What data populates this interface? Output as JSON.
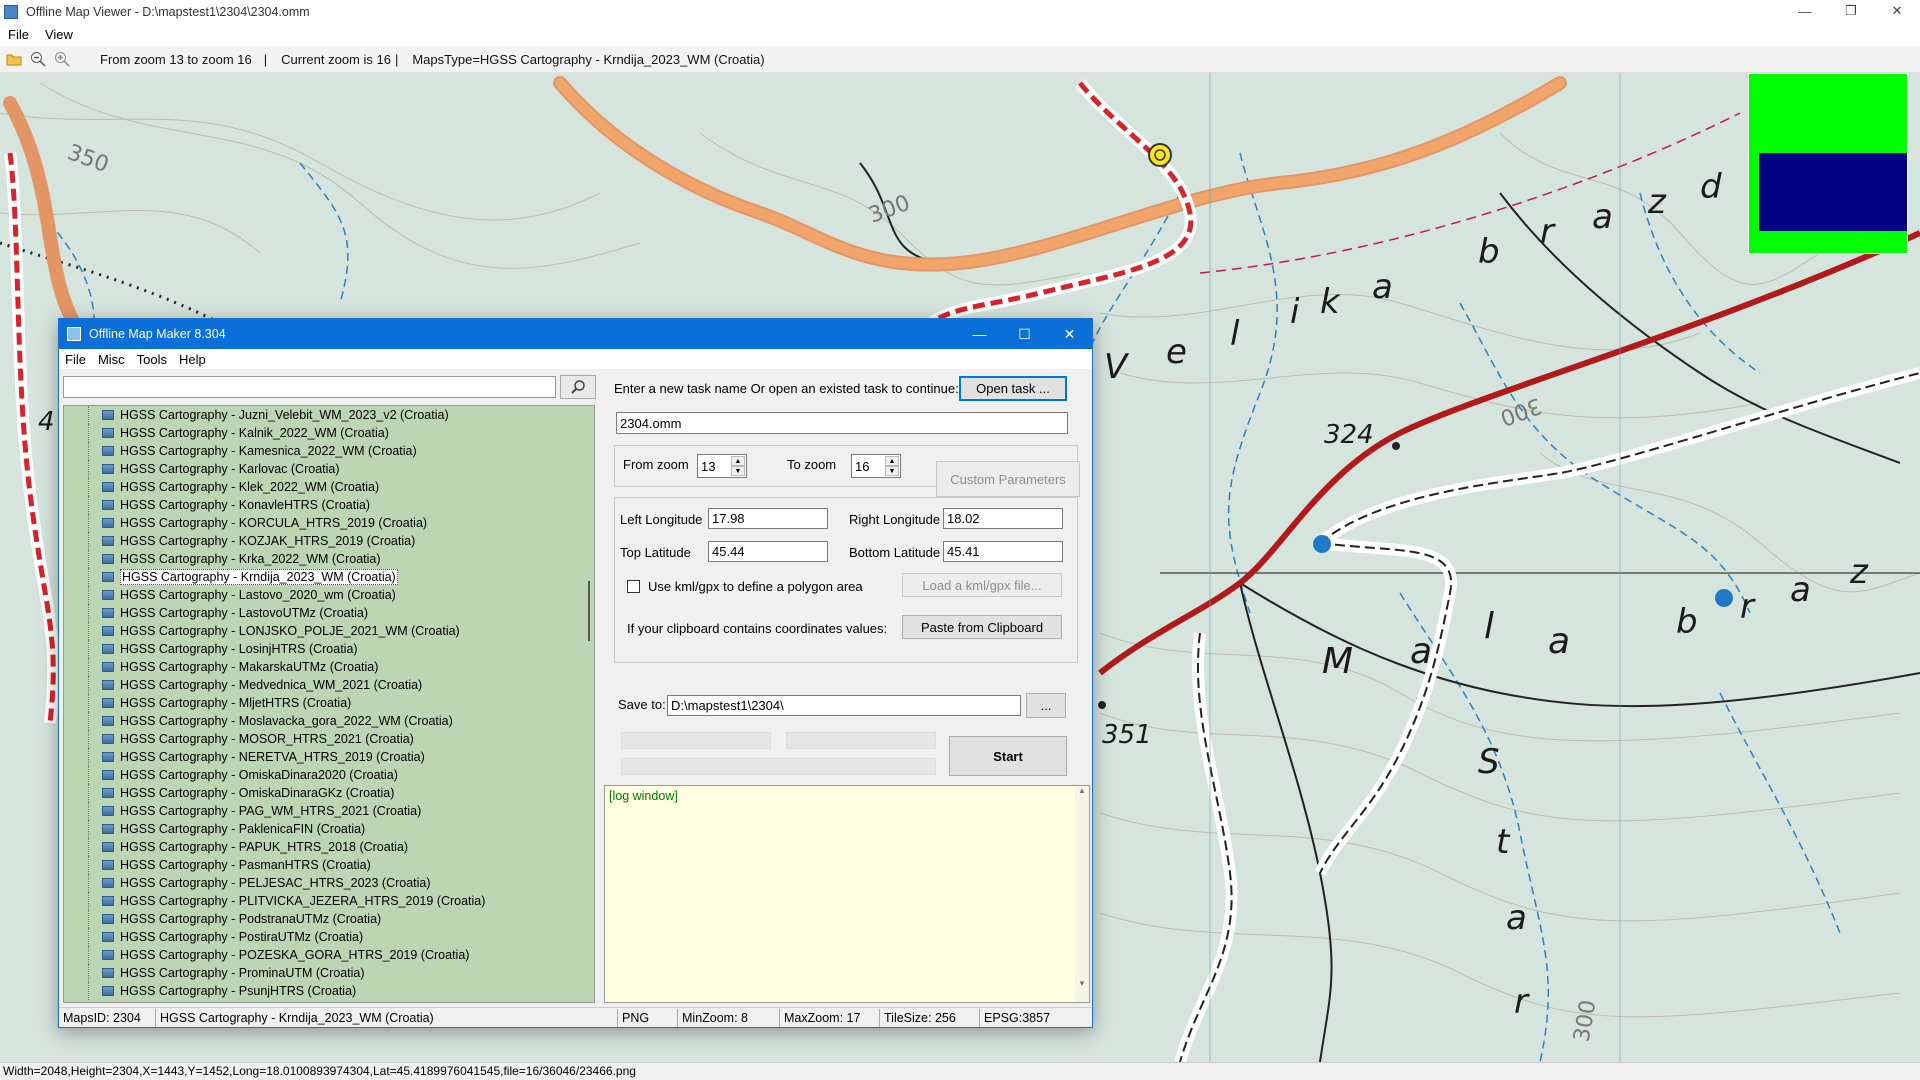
{
  "viewer": {
    "title": "Offline Map Viewer - D:\\mapstest1\\2304\\2304.omm",
    "menu": [
      "File",
      "View"
    ],
    "toolbar": {
      "zoom_range": "From zoom 13 to zoom 16",
      "current_zoom": "Current zoom is 16",
      "maps_type": "MapsType=HGSS Cartography - Krndija_2023_WM (Croatia)",
      "separator": "|"
    },
    "status": "Width=2048,Height=2304,X=1443,Y=1452,Long=18.0100893974304,Lat=45.4189976041545,file=16/36046/23466.png",
    "map_labels": {
      "contour_300a": "300",
      "contour_300b": "300",
      "contour_350": "350",
      "elev_324": "324",
      "elev_351": "351",
      "contour_300c": "300",
      "left_fragment": "4"
    },
    "map_place_names": {
      "velika_letters": [
        "V",
        "e",
        "l",
        "i",
        "k",
        "a"
      ],
      "brazd_top_letters": [
        "b",
        "r",
        "a",
        "z",
        "d"
      ],
      "mala_letters": [
        "M",
        "a",
        "l",
        "a"
      ],
      "brazd_bottom_letters": [
        "b",
        "r",
        "a",
        "z"
      ],
      "st_letters": [
        "S",
        "t",
        "a",
        "r"
      ]
    },
    "colors": {
      "map_bg": "#d5e4dd",
      "road_orange": "#f2a56b",
      "trail_red": "#d8232a",
      "overview_green": "#00ff00",
      "overview_navy": "#000080"
    }
  },
  "dialog": {
    "title": "Offline Map Maker 8.304",
    "menu": [
      "File",
      "Misc",
      "Tools",
      "Help"
    ],
    "search": {
      "value": "",
      "placeholder": ""
    },
    "tree_items": [
      "HGSS Cartography - Juzni_Velebit_WM_2023_v2 (Croatia)",
      "HGSS Cartography - Kalnik_2022_WM (Croatia)",
      "HGSS Cartography - Kamesnica_2022_WM (Croatia)",
      "HGSS Cartography - Karlovac (Croatia)",
      "HGSS Cartography - Klek_2022_WM (Croatia)",
      "HGSS Cartography - KonavleHTRS (Croatia)",
      "HGSS Cartography - KORCULA_HTRS_2019 (Croatia)",
      "HGSS Cartography - KOZJAK_HTRS_2019 (Croatia)",
      "HGSS Cartography - Krka_2022_WM (Croatia)",
      "HGSS Cartography - Krndija_2023_WM (Croatia)",
      "HGSS Cartography - Lastovo_2020_wm (Croatia)",
      "HGSS Cartography - LastovoUTMz (Croatia)",
      "HGSS Cartography - LONJSKO_POLJE_2021_WM (Croatia)",
      "HGSS Cartography - LosinjHTRS (Croatia)",
      "HGSS Cartography - MakarskaUTMz (Croatia)",
      "HGSS Cartography - Medvednica_WM_2021 (Croatia)",
      "HGSS Cartography - MljetHTRS (Croatia)",
      "HGSS Cartography - Moslavacka_gora_2022_WM (Croatia)",
      "HGSS Cartography - MOSOR_HTRS_2021 (Croatia)",
      "HGSS Cartography - NERETVA_HTRS_2019 (Croatia)",
      "HGSS Cartography - OmiskaDinara2020 (Croatia)",
      "HGSS Cartography - OmiskaDinaraGKz (Croatia)",
      "HGSS Cartography - PAG_WM_HTRS_2021 (Croatia)",
      "HGSS Cartography - PaklenicaFIN (Croatia)",
      "HGSS Cartography - PAPUK_HTRS_2018 (Croatia)",
      "HGSS Cartography - PasmanHTRS (Croatia)",
      "HGSS Cartography - PELJESAC_HTRS_2023 (Croatia)",
      "HGSS Cartography - PLITVICKA_JEZERA_HTRS_2019 (Croatia)",
      "HGSS Cartography - PodstranaUTMz (Croatia)",
      "HGSS Cartography - PostiraUTMz (Croatia)",
      "HGSS Cartography - POZESKA_GORA_HTRS_2019 (Croatia)",
      "HGSS Cartography - ProminaUTM (Croatia)",
      "HGSS Cartography - PsunjHTRS (Croatia)"
    ],
    "selected_index": 9,
    "task_prompt": "Enter a new task name Or open an existed task to continue:",
    "open_task_label": "Open task ...",
    "task_name": "2304.omm",
    "from_zoom_label": "From zoom",
    "from_zoom_value": "13",
    "to_zoom_label": "To zoom",
    "to_zoom_value": "16",
    "custom_params_label": "Custom Parameters",
    "left_lon_label": "Left Longitude",
    "left_lon_value": "17.98",
    "right_lon_label": "Right Longitude",
    "right_lon_value": "18.02",
    "top_lat_label": "Top Latitude",
    "top_lat_value": "45.44",
    "bottom_lat_label": "Bottom Latitude",
    "bottom_lat_value": "45.41",
    "kml_check_label": "Use kml/gpx to define a polygon area",
    "kml_checked": false,
    "load_kml_label": "Load a kml/gpx file...",
    "clipboard_text": "If your clipboard contains coordinates values:",
    "paste_label": "Paste from Clipboard",
    "save_to_label": "Save to:",
    "save_to_value": "D:\\mapstest1\\2304\\",
    "browse_label": "...",
    "start_label": "Start",
    "log_text": "[log window]",
    "status": {
      "maps_id": "MapsID: 2304",
      "map_name": "HGSS Cartography - Krndija_2023_WM (Croatia)",
      "format": "PNG",
      "min_zoom": "MinZoom: 8",
      "max_zoom": "MaxZoom: 17",
      "tile_size": "TileSize: 256",
      "epsg": "EPSG:3857"
    }
  }
}
